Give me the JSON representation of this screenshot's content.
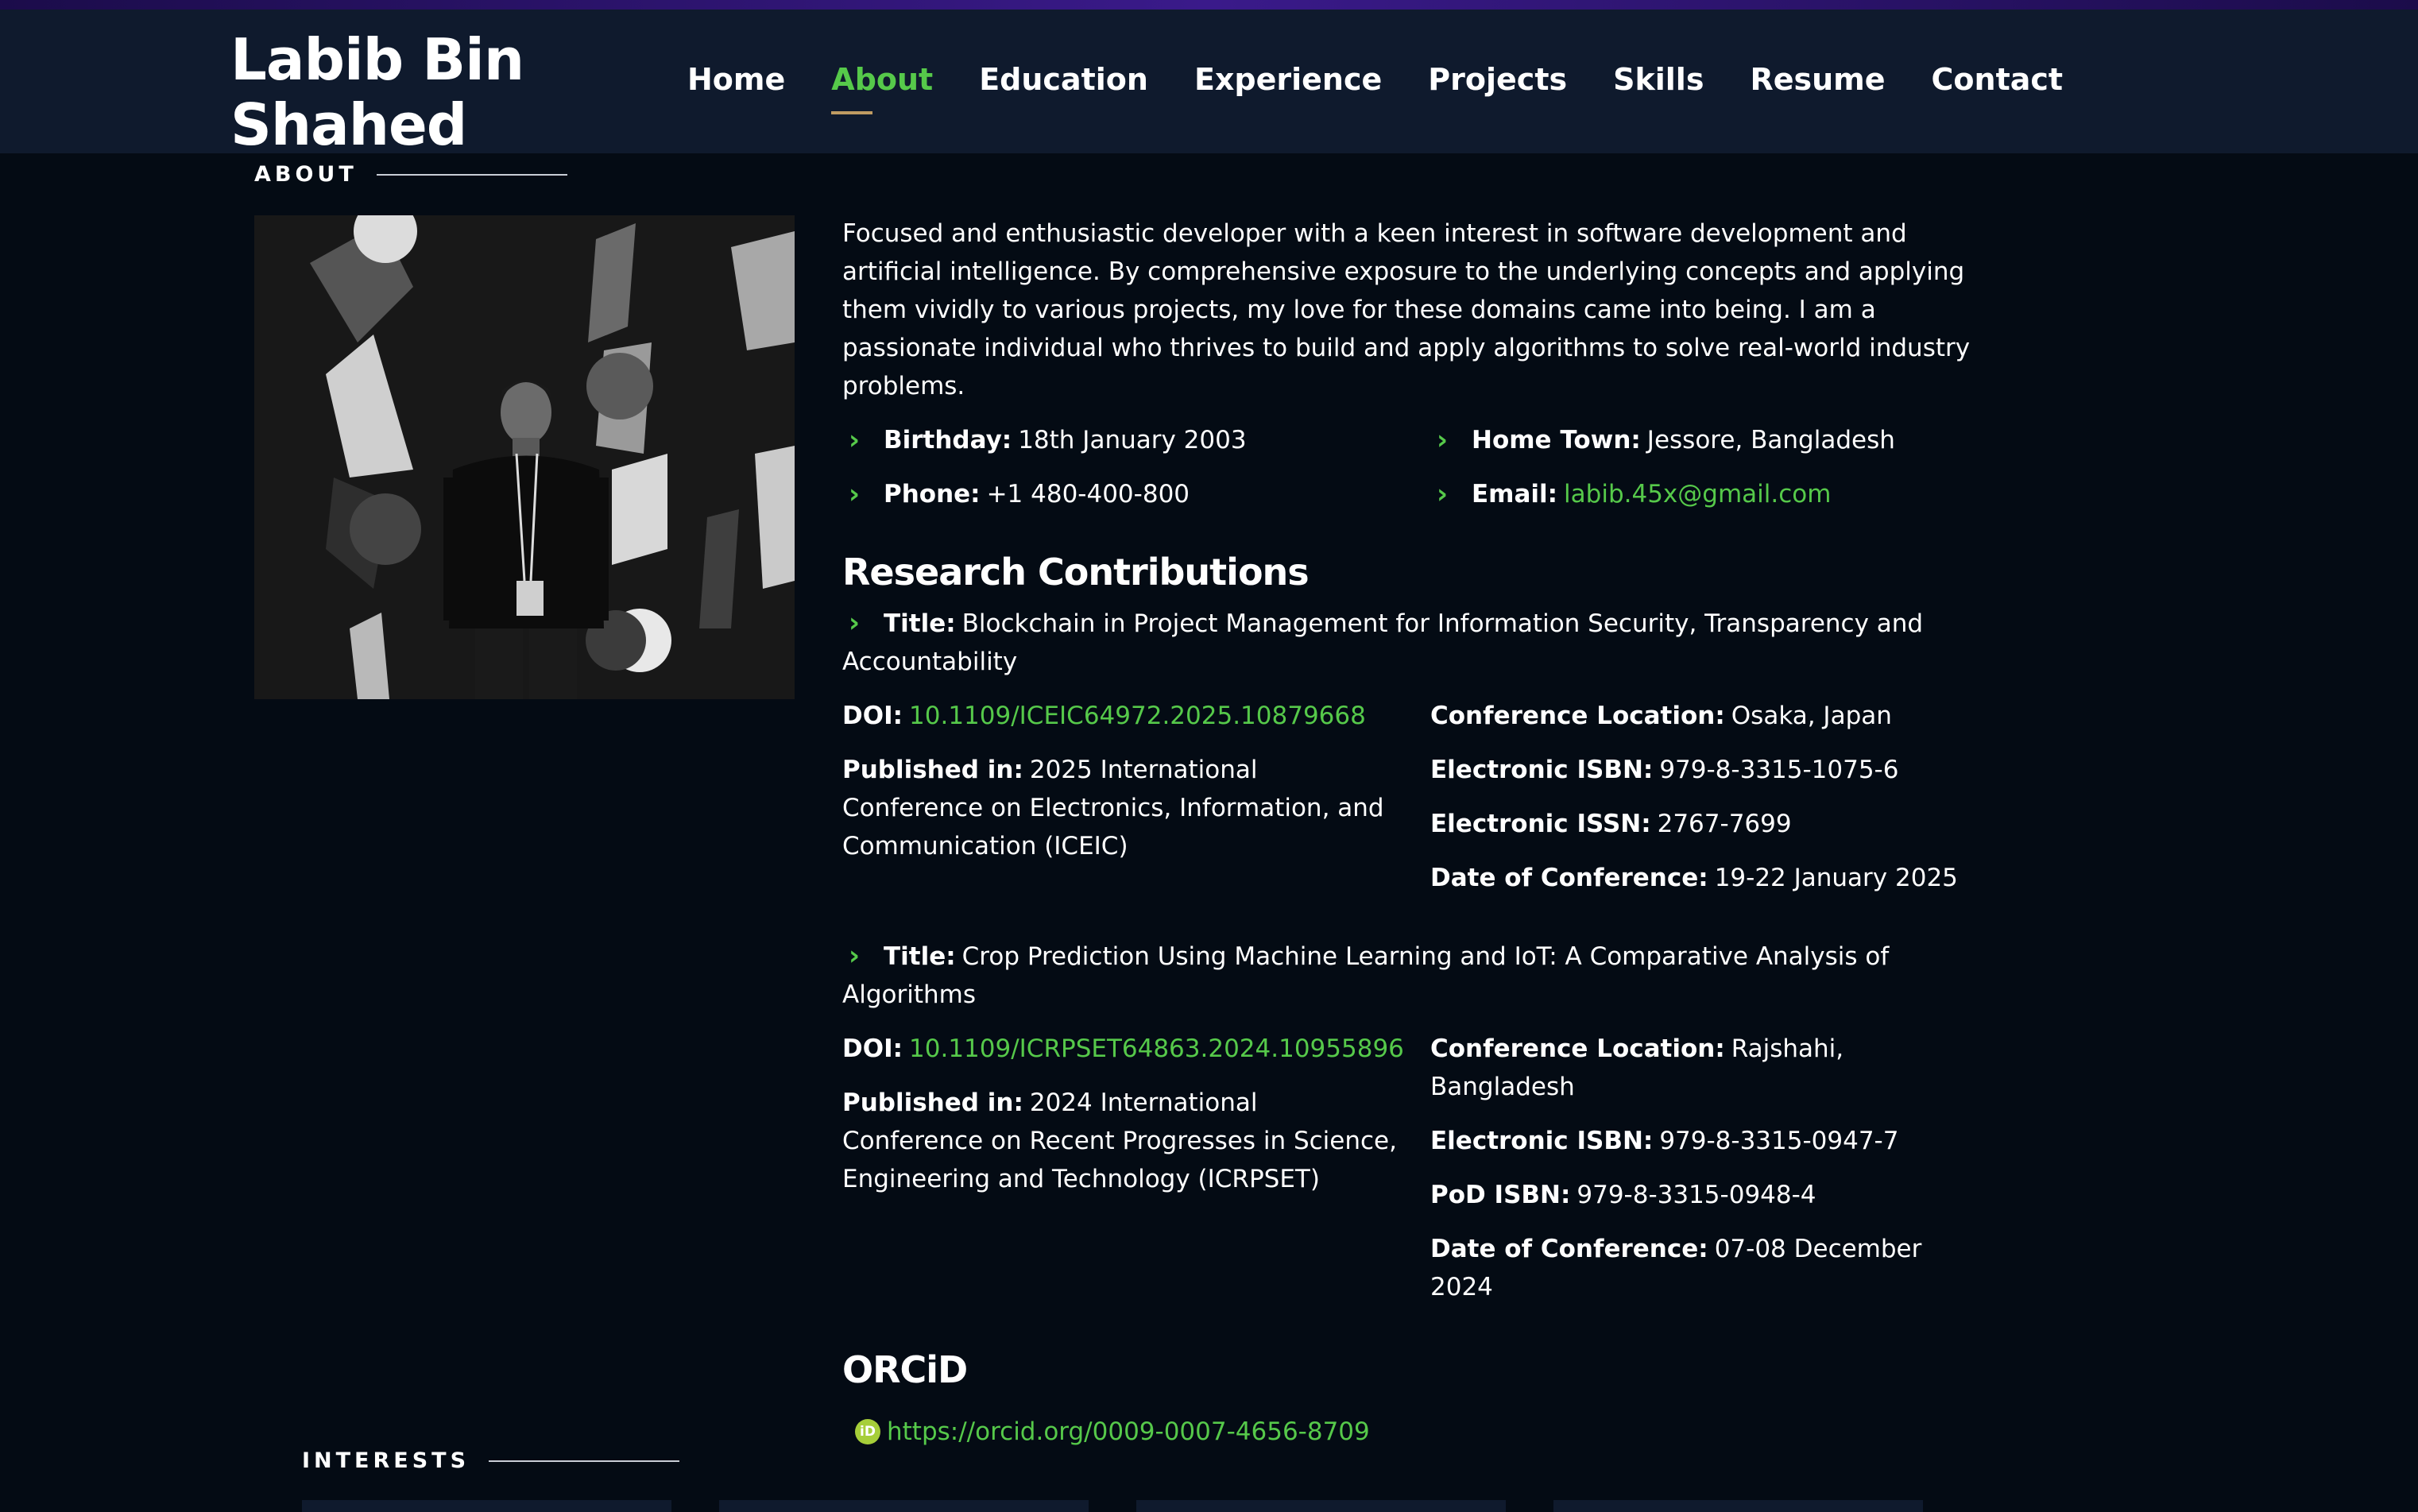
{
  "header": {
    "logo": "Labib Bin Shahed",
    "nav": [
      {
        "label": "Home",
        "active": false
      },
      {
        "label": "About",
        "active": true
      },
      {
        "label": "Education",
        "active": false
      },
      {
        "label": "Experience",
        "active": false
      },
      {
        "label": "Projects",
        "active": false
      },
      {
        "label": "Skills",
        "active": false
      },
      {
        "label": "Resume",
        "active": false
      },
      {
        "label": "Contact",
        "active": false
      }
    ]
  },
  "about": {
    "section_label": "ABOUT",
    "intro": "Focused and enthusiastic developer with a keen interest in software development and artificial intelligence. By comprehensive exposure to the underlying concepts and applying them vividly to various projects, my love for these domains came into being. I am a passionate individual who thrives to build and apply algorithms to solve real-world industry problems.",
    "info": {
      "birthday_label": "Birthday:",
      "birthday": "18th January 2003",
      "hometown_label": "Home Town:",
      "hometown": "Jessore, Bangladesh",
      "phone_label": "Phone:",
      "phone": "+1 480-400-800",
      "email_label": "Email:",
      "email": "labib.45x@gmail.com"
    }
  },
  "research": {
    "heading": "Research Contributions",
    "title_label": "Title:",
    "doi_label": "DOI:",
    "published_label": "Published in:",
    "location_label": "Conference Location:",
    "eisbn_label": "Electronic ISBN:",
    "eissn_label": "Electronic ISSN:",
    "podisbn_label": "PoD ISBN:",
    "date_label": "Date of Conference:",
    "items": [
      {
        "title": "Blockchain in Project Management for Information Security, Transparency and Accountability",
        "doi": "10.1109/ICEIC64972.2025.10879668",
        "published": "2025 International Conference on Electronics, Information, and Communication (ICEIC)",
        "location": "Osaka, Japan",
        "isbn": "979-8-3315-1075-6",
        "issn": "2767-7699",
        "date": "19-22 January 2025"
      },
      {
        "title": "Crop Prediction Using Machine Learning and IoT: A Comparative Analysis of Algorithms",
        "doi": "10.1109/ICRPSET64863.2024.10955896",
        "published": "2024 International Conference on Recent Progresses in Science, Engineering and Technology (ICRPSET)",
        "location": "Rajshahi, Bangladesh",
        "isbn": "979-8-3315-0947-7",
        "pod_isbn": "979-8-3315-0948-4",
        "date": "07-08 December 2024"
      }
    ]
  },
  "orcid": {
    "heading": "ORCiD",
    "icon_text": "iD",
    "url": "https://orcid.org/0009-0007-4656-8709"
  },
  "interests": {
    "section_label": "INTERESTS"
  },
  "colors": {
    "accent": "#56c94a",
    "header_bg": "#0f1a2d",
    "page_bg": "#040b14",
    "underline": "#bf9b62"
  }
}
